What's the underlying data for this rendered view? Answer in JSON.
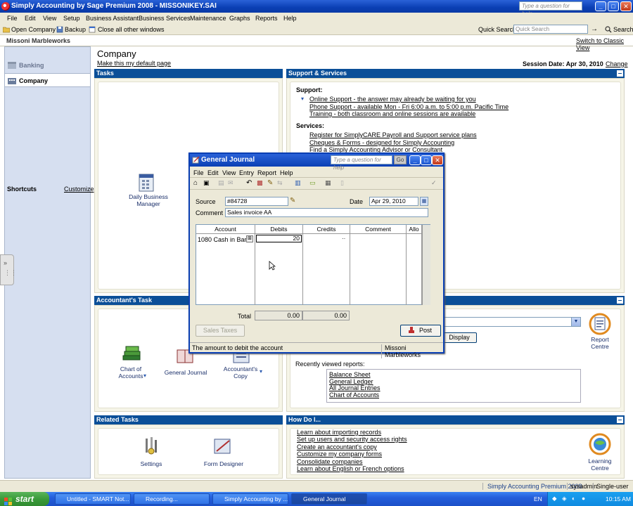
{
  "window": {
    "title": "Simply Accounting by Sage Premium 2008 - MISSONIKEY.SAI",
    "help_placeholder": "Type a question for help",
    "min": "_",
    "max": "□",
    "close": "✕"
  },
  "menu": [
    "File",
    "Edit",
    "View",
    "Setup",
    "Business Assistant",
    "Business Services",
    "Maintenance",
    "Graphs",
    "Reports",
    "Help"
  ],
  "toolbar": {
    "open_company": "Open Company",
    "backup": "Backup",
    "close_all": "Close all other windows",
    "quick_search_label": "Quick Search:",
    "quick_search_placeholder": "Quick Search",
    "search_button": "Search"
  },
  "company_header": {
    "company_name": "Missoni Marbleworks",
    "switch_link": "Switch to Classic View"
  },
  "leftnav": {
    "items": [
      {
        "label": "Banking"
      },
      {
        "label": "Company"
      }
    ],
    "shortcuts": "Shortcuts",
    "customize": "Customize"
  },
  "page": {
    "title": "Company",
    "default_link": "Make this my default page",
    "session_label": "Session Date: Apr 30, 2010",
    "change_link": "Change"
  },
  "tasks": {
    "header": "Tasks",
    "daily_business_manager": "Daily Business Manager"
  },
  "support": {
    "header": "Support & Services",
    "support_label": "Support:",
    "support_links": [
      "Online Support - the answer may already be waiting for you",
      "Phone Support - available Mon - Fri 6:00 a.m. to 5:00 p.m. Pacific Time",
      "Training - both classroom and online sessions are available"
    ],
    "services_label": "Services:",
    "service_links": [
      "Register for SimplyCARE Payroll and Support service plans",
      "Cheques & Forms - designed for Simply Accounting",
      "Find a Simply Accounting Advisor or Consultant"
    ]
  },
  "accountant": {
    "header": "Accountant's Task",
    "chart_of_accounts": "Chart of Accounts",
    "general_journal": "General Journal",
    "accountants_copy": "Accountant's Copy"
  },
  "reports": {
    "display_button": "Display",
    "report_centre": "Report Centre",
    "recently_viewed": "Recently viewed reports:",
    "recent": [
      "Balance Sheet",
      "General Ledger",
      "All Journal Entries",
      "Chart of Accounts"
    ]
  },
  "related": {
    "header": "Related Tasks",
    "settings": "Settings",
    "form_designer": "Form Designer"
  },
  "howdo": {
    "header": "How Do I...",
    "links": [
      "Learn about importing records",
      "Set up users and security access rights",
      "Create an accountant's copy",
      "Customize my company forms",
      "Consolidate companies",
      "Learn about English or French options"
    ],
    "learning_centre": "Learning Centre"
  },
  "statusbar": {
    "product": "Simply Accounting Premium 2008",
    "user": "sysadmin",
    "mode": "Single-user"
  },
  "dialog": {
    "title": "General Journal",
    "help_placeholder": "Type a question for help",
    "go": "Go",
    "menu": [
      "File",
      "Edit",
      "View",
      "Entry",
      "Report",
      "Help"
    ],
    "source_label": "Source",
    "source_value": "#84728",
    "date_label": "Date",
    "date_value": "Apr 29, 2010",
    "comment_label": "Comment",
    "comment_value": "Sales invoice AA",
    "columns": [
      "Account",
      "Debits",
      "Credits",
      "Comment",
      "Allo"
    ],
    "row": {
      "account": "1080 Cash in Bank",
      "debit": "20",
      "credit": "··"
    },
    "total_label": "Total",
    "total_debits": "0.00",
    "total_credits": "0.00",
    "sales_taxes": "Sales Taxes",
    "post": "Post",
    "status_text": "The amount to debit the account",
    "status_company": "Missoni Marbleworks"
  },
  "taskbar": {
    "start": "start",
    "tasks": [
      "Untitled - SMART Not...",
      "Recording...",
      "Simply Accounting by ...",
      "General Journal"
    ],
    "lang": "EN",
    "time": "10:15 AM"
  }
}
